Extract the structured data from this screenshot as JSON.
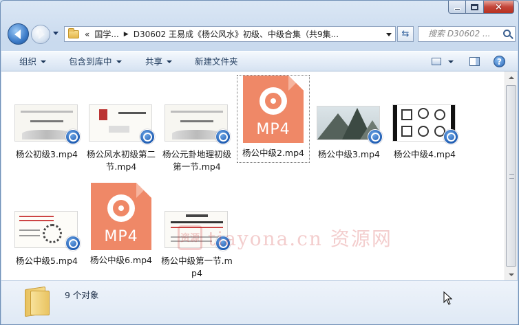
{
  "window": {
    "caption": {
      "minimize": "minimize",
      "maximize": "maximize",
      "close": "×"
    }
  },
  "nav": {
    "breadcrumb": [
      "«",
      "国学...",
      "D30602 王易成《杨公风水》初级、中级合集（共9集..."
    ],
    "search_placeholder": "搜索 D30602 ..."
  },
  "toolbar": {
    "organize": "组织",
    "include_in_library": "包含到库中",
    "share": "共享",
    "new_folder": "新建文件夹",
    "help": "?"
  },
  "files": [
    {
      "name": "杨公初级3.mp4",
      "thumb": "slide-landscape"
    },
    {
      "name": "杨公风水初级第二节.mp4",
      "thumb": "slide-seal"
    },
    {
      "name": "杨公元卦地理初级第一节.mp4",
      "thumb": "slide-landscape"
    },
    {
      "name": "杨公中级2.mp4",
      "thumb": "mp4-icon",
      "selected": true
    },
    {
      "name": "杨公中级3.mp4",
      "thumb": "mountain-photo"
    },
    {
      "name": "杨公中级4.mp4",
      "thumb": "diagram-grid"
    },
    {
      "name": "杨公中级5.mp4",
      "thumb": "slide-diagram"
    },
    {
      "name": "杨公中级6.mp4",
      "thumb": "mp4-icon"
    },
    {
      "name": "杨公中级第一节.mp4",
      "thumb": "slide-text"
    }
  ],
  "mp4_label": "MP4",
  "watermark": {
    "seal": "资源",
    "text": "tiayona.cn 资源网"
  },
  "status": {
    "count": "9 个对象"
  },
  "colors": {
    "mp4_orange": "#ef8867",
    "badge_blue": "#1f5db3",
    "accent": "#c9daee"
  }
}
